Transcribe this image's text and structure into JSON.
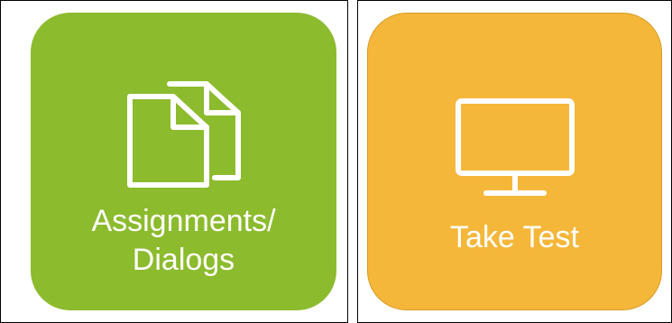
{
  "tiles": {
    "assignments": {
      "label_line1": "Assignments/",
      "label_line2": "Dialogs",
      "icon": "documents-icon",
      "color": "#8cbb2e"
    },
    "take_test": {
      "label": "Take Test",
      "icon": "monitor-icon",
      "color": "#f5b73a"
    }
  }
}
